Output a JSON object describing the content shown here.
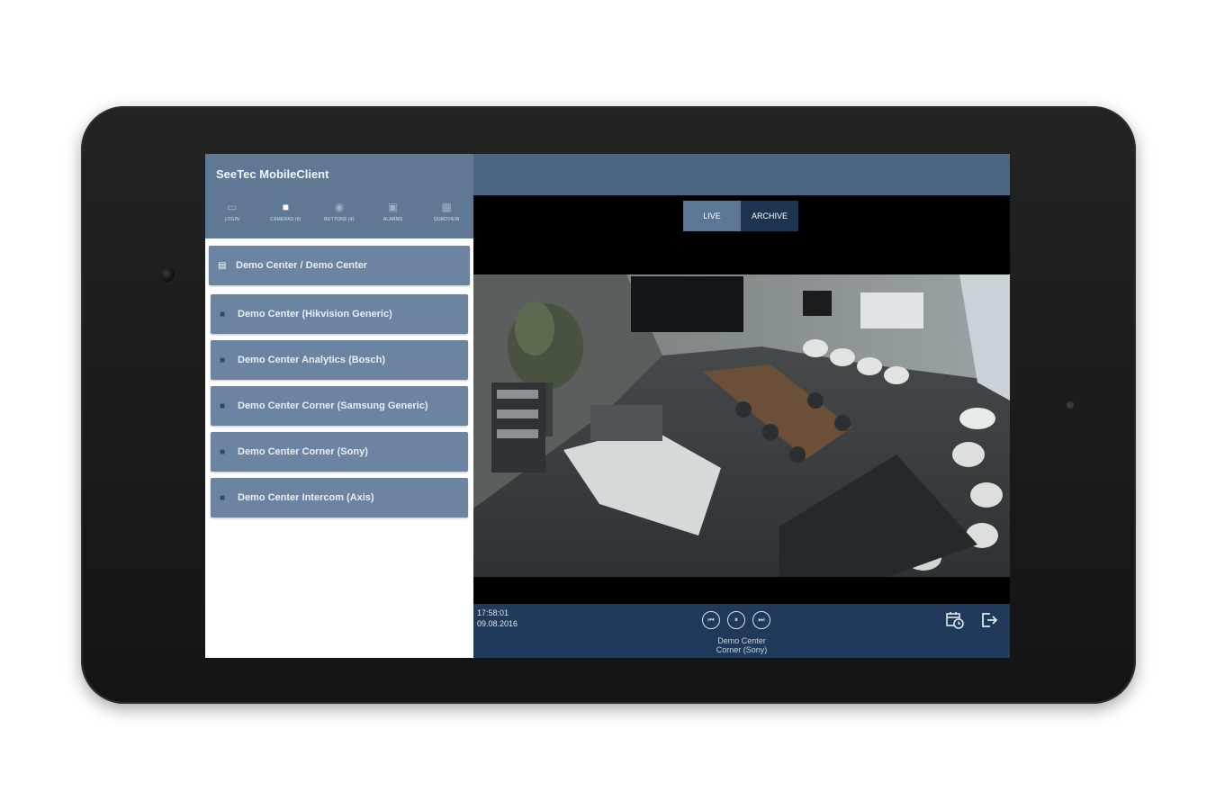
{
  "app": {
    "title": "SeeTec MobileClient"
  },
  "nav_tabs": [
    {
      "label": "LOGIN",
      "icon": "login-icon"
    },
    {
      "label": "CAMERAS (6)",
      "icon": "camera-icon"
    },
    {
      "label": "BUTTONS (4)",
      "icon": "buttons-icon"
    },
    {
      "label": "ALARMS",
      "icon": "alarm-icon"
    },
    {
      "label": "QUADVIEW",
      "icon": "quadview-icon"
    }
  ],
  "camera_list": [
    {
      "label": "Demo Center / Demo Center",
      "type": "group"
    },
    {
      "label": "Demo Center (Hikvision Generic)",
      "type": "camera"
    },
    {
      "label": "Demo Center Analytics (Bosch)",
      "type": "camera"
    },
    {
      "label": "Demo Center Corner (Samsung Generic)",
      "type": "camera"
    },
    {
      "label": "Demo Center Corner (Sony)",
      "type": "camera"
    },
    {
      "label": "Demo Center Intercom (Axis)",
      "type": "camera"
    }
  ],
  "mode": {
    "live": "LIVE",
    "archive": "ARCHIVE"
  },
  "playback": {
    "time": "17:58:01",
    "date": "09.08.2016",
    "camera_line1": "Demo Center",
    "camera_line2": "Corner (Sony)"
  },
  "colors": {
    "header": "#5f7893",
    "list_item": "#6b84a2",
    "bottom_bar": "#1f3a5a",
    "archive_button": "#1e3552"
  }
}
